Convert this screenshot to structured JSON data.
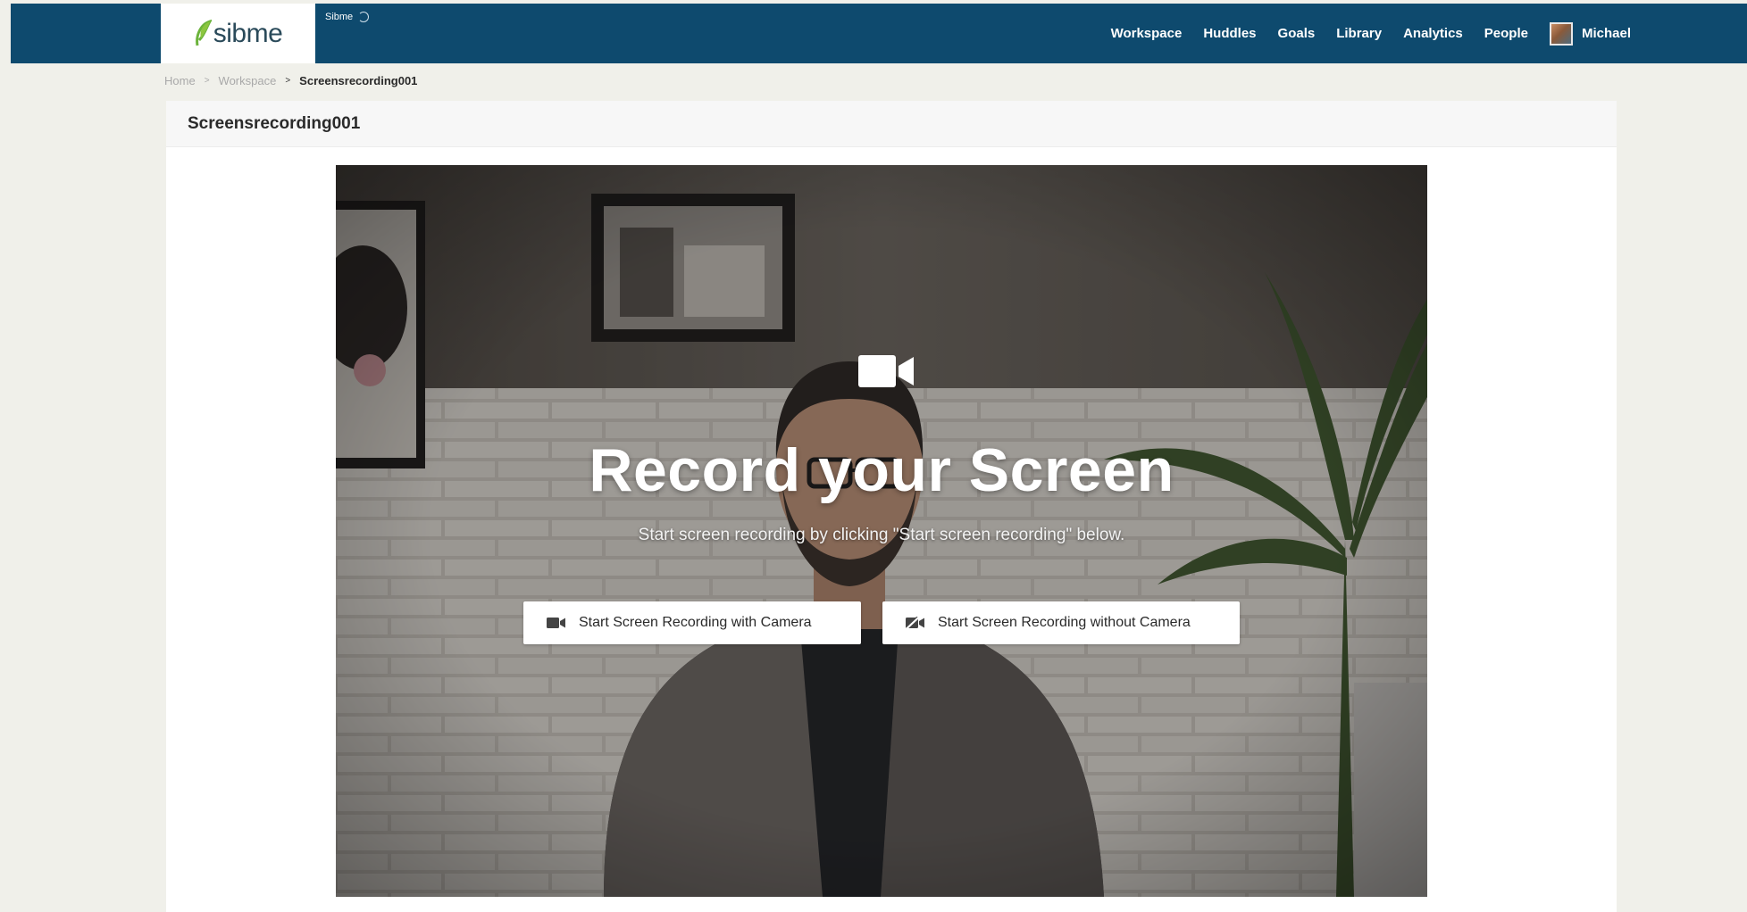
{
  "account": {
    "name": "Sibme"
  },
  "logo": {
    "text": "sibme"
  },
  "nav": {
    "items": [
      {
        "label": "Workspace"
      },
      {
        "label": "Huddles"
      },
      {
        "label": "Goals"
      },
      {
        "label": "Library"
      },
      {
        "label": "Analytics"
      },
      {
        "label": "People"
      }
    ],
    "user_name": "Michael"
  },
  "breadcrumb": {
    "home": "Home",
    "workspace": "Workspace",
    "current": "Screensrecording001"
  },
  "page": {
    "title": "Screensrecording001"
  },
  "hero": {
    "icon": "video-camera-icon",
    "title": "Record your Screen",
    "subtitle": "Start screen recording by clicking \"Start screen recording\" below.",
    "button_with_camera": "Start Screen Recording with Camera",
    "button_without_camera": "Start Screen Recording without Camera"
  },
  "colors": {
    "nav_background": "#0e4a6e",
    "page_background": "#f0f0ea",
    "card_background": "#ffffff",
    "logo_leaf": "#6bb33b"
  }
}
